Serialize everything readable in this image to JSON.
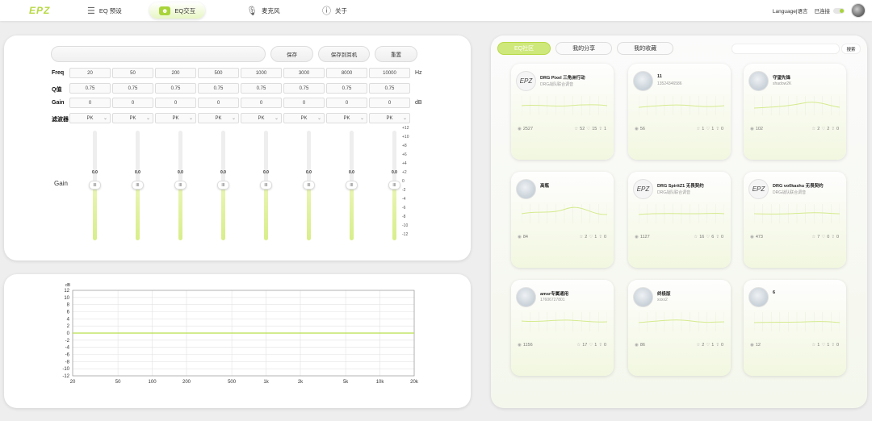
{
  "app": {
    "logo": "EPZ"
  },
  "nav": [
    {
      "label": "EQ 预设",
      "icon": "sliders-icon",
      "glyph": "☰"
    },
    {
      "label": "EQ交互",
      "icon": "eq-interact-icon",
      "glyph": "☻"
    },
    {
      "label": "麦克风",
      "icon": "microphone-icon",
      "glyph": "🎙"
    },
    {
      "label": "关于",
      "icon": "info-icon",
      "glyph": "ⓘ"
    }
  ],
  "topright": {
    "language": "Language|语言",
    "status": "已连接"
  },
  "editor": {
    "name_value": "",
    "buttons": {
      "save": "保存",
      "save_device": "保存到耳机",
      "reset": "重置"
    },
    "labels": {
      "freq": "Freq",
      "q": "Q值",
      "gain": "Gain",
      "filter": "滤波器",
      "gain_side": "Gain"
    },
    "units": {
      "freq": "Hz",
      "gain": "dB"
    },
    "freq": [
      "20",
      "50",
      "200",
      "500",
      "1000",
      "3000",
      "8000",
      "10000"
    ],
    "q": [
      "0.75",
      "0.75",
      "0.75",
      "0.75",
      "0.75",
      "0.75",
      "0.75",
      "0.75"
    ],
    "gain": [
      "0",
      "0",
      "0",
      "0",
      "0",
      "0",
      "0",
      "0"
    ],
    "filter": [
      "PK",
      "PK",
      "PK",
      "PK",
      "PK",
      "PK",
      "PK",
      "PK"
    ],
    "slider_values": [
      "0.0",
      "0.0",
      "0.0",
      "0.0",
      "0.0",
      "0.0",
      "0.0",
      "0.0"
    ],
    "knob_glyph": "III",
    "scale": [
      "+12",
      "+10",
      "+8",
      "+6",
      "+4",
      "+2",
      "0",
      "-2",
      "-4",
      "-6",
      "-8",
      "-10",
      "-12"
    ]
  },
  "chart_data": {
    "type": "line",
    "xlabel": "",
    "ylabel": "dB",
    "x_scale": "log",
    "xlim": [
      20,
      20000
    ],
    "ylim": [
      -12,
      12
    ],
    "x_ticks": [
      "20",
      "50",
      "100",
      "200",
      "500",
      "1k",
      "2k",
      "5k",
      "10k",
      "20k"
    ],
    "x_tick_values": [
      20,
      50,
      100,
      200,
      500,
      1000,
      2000,
      5000,
      10000,
      20000
    ],
    "y_ticks": [
      12,
      10,
      8,
      6,
      4,
      2,
      0,
      -2,
      -4,
      -6,
      -8,
      -10,
      -12
    ],
    "grid": true,
    "color": "#b7e04a",
    "series": [
      {
        "x": [
          20,
          20000
        ],
        "y": [
          0,
          0
        ]
      }
    ]
  },
  "community": {
    "tabs": [
      "EQ社区",
      "我的分享",
      "我的收藏"
    ],
    "search_button": "搜索",
    "cards": [
      {
        "title": "DRG Pixel 三角洲行动",
        "sub": "DRG战队联合调音",
        "avatar": "epz",
        "views": "2527",
        "stars": "52",
        "likes": "15",
        "shares": "1"
      },
      {
        "title": "11",
        "sub": "13524346586",
        "avatar": "anime",
        "views": "56",
        "stars": "1",
        "likes": "1",
        "shares": "0"
      },
      {
        "title": "守望先锋",
        "sub": "shadow2K",
        "avatar": "anime",
        "views": "102",
        "stars": "2",
        "likes": "2",
        "shares": "0"
      },
      {
        "title": "高瓶",
        "sub": "",
        "avatar": "anime",
        "views": "84",
        "stars": "2",
        "likes": "1",
        "shares": "0"
      },
      {
        "title": "DRG SpiritZ1 无畏契约",
        "sub": "DRG战队联合调音",
        "avatar": "epz",
        "views": "1127",
        "stars": "16",
        "likes": "6",
        "shares": "0"
      },
      {
        "title": "DRG vo0kashu 无畏契约",
        "sub": "DRG战队联合调音",
        "avatar": "epz",
        "views": "473",
        "stars": "7",
        "likes": "0",
        "shares": "0"
      },
      {
        "title": "amsr专属通用",
        "sub": "17606727801",
        "avatar": "anime",
        "views": "1156",
        "stars": "17",
        "likes": "1",
        "shares": "0"
      },
      {
        "title": "终极版",
        "sub": "xxxx2",
        "avatar": "anime",
        "views": "86",
        "stars": "2",
        "likes": "1",
        "shares": "0"
      },
      {
        "title": "6",
        "sub": "",
        "avatar": "anime",
        "views": "12",
        "stars": "1",
        "likes": "1",
        "shares": "0"
      }
    ]
  }
}
